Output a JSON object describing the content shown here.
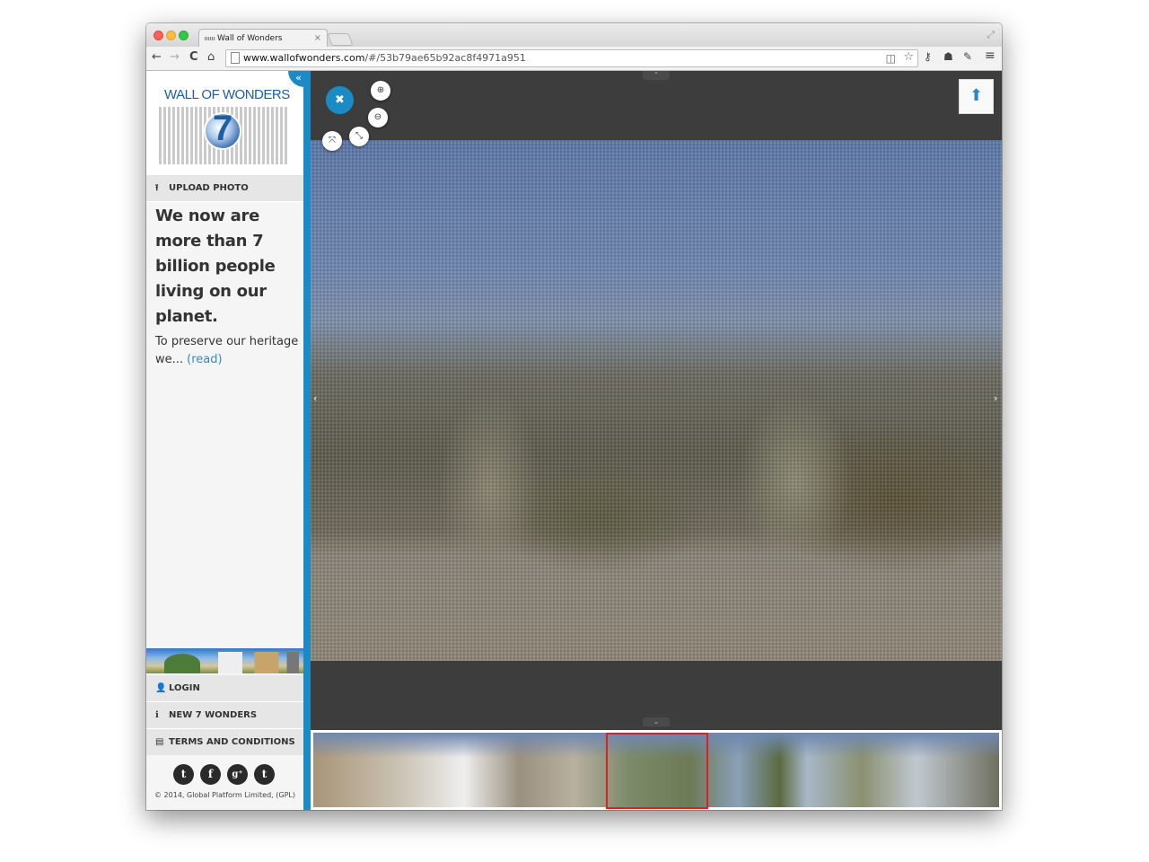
{
  "browser": {
    "tab_title": "Wall of Wonders",
    "tab_close": "×",
    "url_domain": "www.wallofwonders.com",
    "url_path": "/#/53b79ae65b92ac8f4971a951",
    "icons": {
      "back": "←",
      "forward": "→",
      "reload": "C",
      "home": "⌂",
      "reader": "◫",
      "bookmark": "☆",
      "ext1": "⚷",
      "ext2": "☗",
      "ext3": "✎",
      "menu": "≡",
      "fullscreen": "⤢"
    }
  },
  "sidebar": {
    "collapse_icon": "«",
    "logo_title": "WALL OF WONDERS",
    "logo_seven": "7",
    "upload": {
      "icon": "⭱",
      "label": "UPLOAD PHOTO"
    },
    "intro": {
      "heading": "We now are more than 7 billion people living on our planet.",
      "body": "To preserve our heritage we...",
      "read_link": "(read)"
    },
    "menu": [
      {
        "icon": "👤",
        "label": "LOGIN"
      },
      {
        "icon": "ℹ",
        "label": "NEW 7 WONDERS"
      },
      {
        "icon": "▤",
        "label": "TERMS AND CONDITIONS"
      }
    ],
    "social": [
      {
        "name": "twitter",
        "glyph": "t"
      },
      {
        "name": "facebook",
        "glyph": "f"
      },
      {
        "name": "google-plus",
        "glyph": "g⁺"
      },
      {
        "name": "tumblr",
        "glyph": "t"
      }
    ],
    "copyright": "© 2014, Global Platform Limited, (GPL)"
  },
  "viewer": {
    "close_icon": "✖",
    "zoom_in_icon": "⊕",
    "zoom_out_icon": "⊖",
    "fit_icon": "⤧",
    "shrink_icon": "⤡",
    "upload_icon": "⬆",
    "prev_icon": "‹",
    "next_icon": "›",
    "handle_up": "⌃",
    "handle_down": "⌄"
  }
}
